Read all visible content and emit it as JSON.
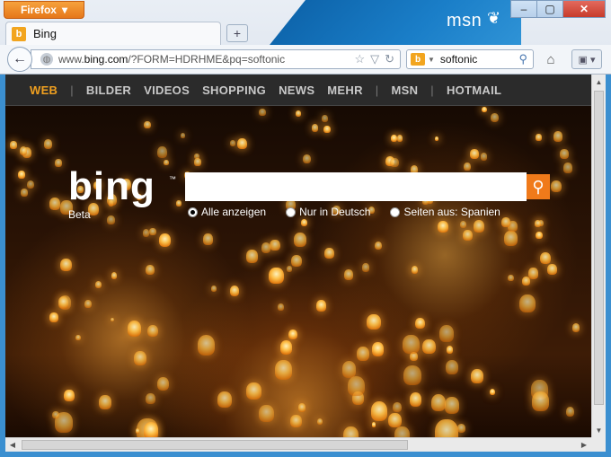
{
  "browser": {
    "menu_button_label": "Firefox",
    "window_controls": [
      "–",
      "▢",
      "✕"
    ],
    "tab": {
      "title": "Bing",
      "favicon": "b"
    },
    "new_tab": "+",
    "url": {
      "prefix": "www.",
      "domain": "bing.com",
      "rest": "/?FORM=HDRHME&pq=softonic"
    },
    "search": {
      "engine_icon": "b",
      "query": "softonic"
    },
    "branding": {
      "text": "msn"
    },
    "icons": [
      "back-arrow-icon",
      "globe-icon",
      "bookmark-star-icon",
      "dropdown-icon",
      "reload-icon",
      "search-icon",
      "home-icon",
      "menu-icon"
    ]
  },
  "bing": {
    "nav": {
      "items": [
        "WEB",
        "BILDER",
        "VIDEOS",
        "SHOPPING",
        "NEWS",
        "MEHR"
      ],
      "extra": [
        "MSN",
        "HOTMAIL"
      ],
      "separator": "|",
      "active_color": "#f0a020"
    },
    "logo": {
      "text": "bing",
      "tm": "™",
      "sub": "Beta"
    },
    "search": {
      "button": "⚲"
    },
    "options": [
      {
        "label": "Alle anzeigen",
        "selected": true
      },
      {
        "label": "Nur in Deutsch",
        "selected": false
      },
      {
        "label": "Seiten aus: Spanien",
        "selected": false
      }
    ]
  }
}
